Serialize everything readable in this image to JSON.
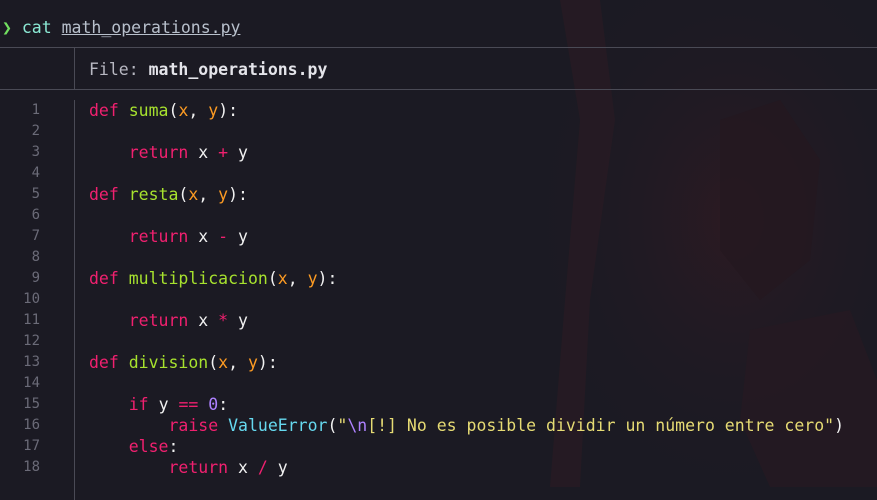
{
  "prompt": {
    "arrow": "❯",
    "command": "cat",
    "argument": "math_operations.py"
  },
  "header": {
    "label": "File: ",
    "filename": "math_operations.py"
  },
  "line_numbers": [
    "1",
    "2",
    "3",
    "4",
    "5",
    "6",
    "7",
    "8",
    "9",
    "10",
    "11",
    "12",
    "13",
    "14",
    "15",
    "16",
    "17",
    "18"
  ],
  "code": {
    "l1": {
      "kw": "def",
      "fn": "suma",
      "p1": "x",
      "p2": "y"
    },
    "l3": {
      "kw": "return",
      "a": "x",
      "op": "+",
      "b": "y"
    },
    "l5": {
      "kw": "def",
      "fn": "resta",
      "p1": "x",
      "p2": "y"
    },
    "l7": {
      "kw": "return",
      "a": "x",
      "op": "-",
      "b": "y"
    },
    "l9": {
      "kw": "def",
      "fn": "multiplicacion",
      "p1": "x",
      "p2": "y"
    },
    "l11": {
      "kw": "return",
      "a": "x",
      "op": "*",
      "b": "y"
    },
    "l13": {
      "kw": "def",
      "fn": "division",
      "p1": "x",
      "p2": "y"
    },
    "l15": {
      "kw": "if",
      "a": "y",
      "op": "==",
      "num": "0"
    },
    "l16": {
      "kw": "raise",
      "cls": "ValueError",
      "esc": "\\n",
      "str": "[!] No es posible dividir un número entre cero"
    },
    "l17": {
      "kw": "else"
    },
    "l18": {
      "kw": "return",
      "a": "x",
      "op": "/",
      "b": "y"
    }
  },
  "colors": {
    "background": "#1b1a23",
    "keyword": "#f0206f",
    "function": "#a7e22e",
    "parameter": "#fd9b23",
    "class": "#66d9ef",
    "number": "#ae81ff",
    "string": "#e6db74",
    "prompt_arrow": "#72e060"
  }
}
